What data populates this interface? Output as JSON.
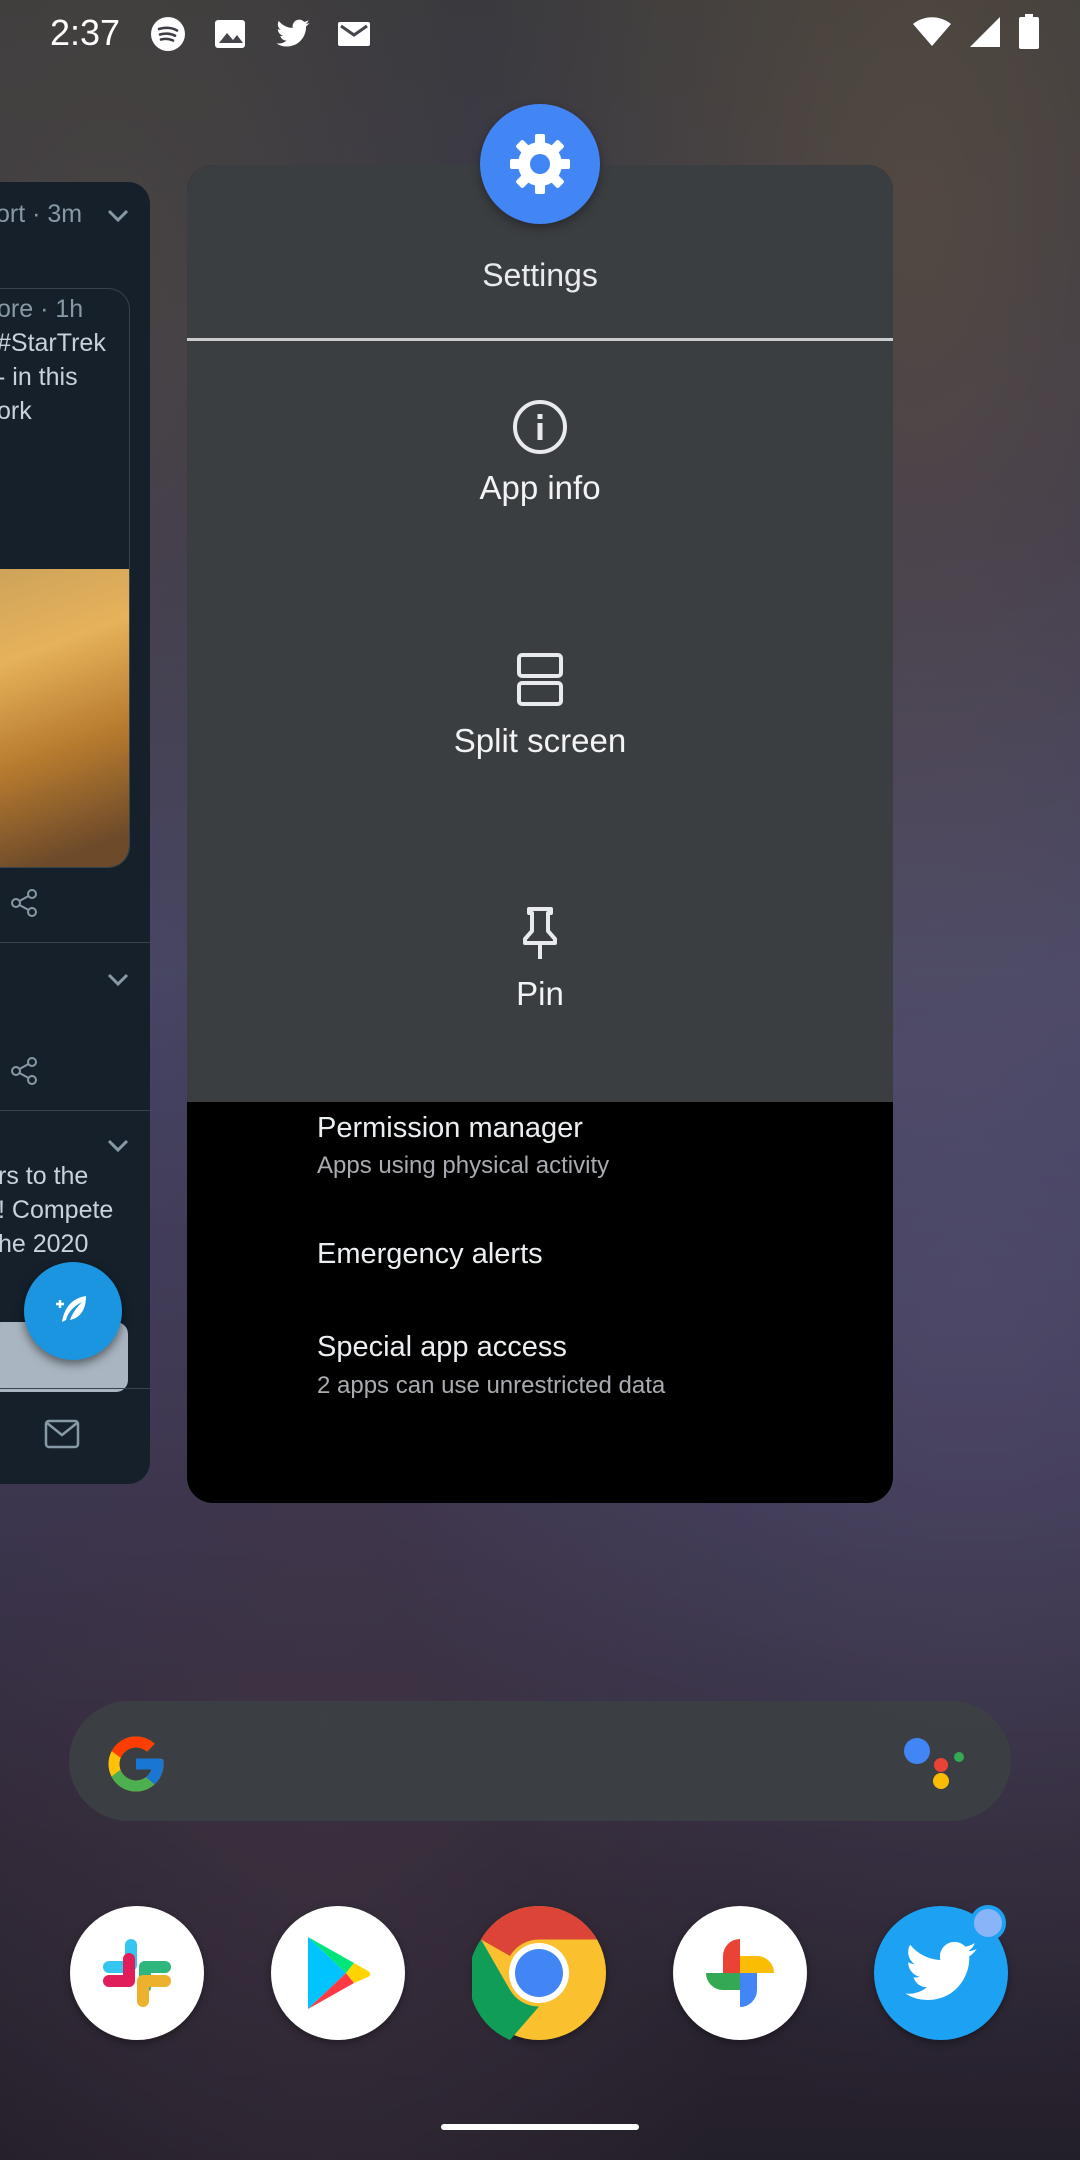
{
  "status_bar": {
    "time": "2:37",
    "left_icons": [
      "spotify-icon",
      "image-icon",
      "twitter-icon",
      "gmail-icon"
    ],
    "right_icons": [
      "wifi-icon",
      "signal-icon",
      "battery-icon"
    ]
  },
  "twitter_card": {
    "lines": [
      "ort · 3m",
      "ore · 1h",
      "#StarTrek",
      "- in this",
      "ork",
      "rs to the",
      "! Compete",
      "he 2020"
    ],
    "accent": "#1b95e0"
  },
  "recent_app": {
    "title": "Settings",
    "menu_items": [
      {
        "label": "App info",
        "icon": "info-icon"
      },
      {
        "label": "Split screen",
        "icon": "split-screen-icon"
      },
      {
        "label": "Pin",
        "icon": "pin-icon"
      }
    ],
    "background_list": [
      {
        "title": "Permission manager",
        "subtitle": "Apps using physical activity"
      },
      {
        "title": "Emergency alerts",
        "subtitle": ""
      },
      {
        "title": "Special app access",
        "subtitle": "2 apps can use unrestricted data"
      }
    ]
  },
  "search": {
    "logo": "google-g-icon",
    "assistant": "google-assistant-icon"
  },
  "dock": [
    "Slack",
    "Play Store",
    "Chrome",
    "Photos",
    "Twitter"
  ],
  "colors": {
    "menu_panel": "#3b3e41",
    "settings_icon": "#4285f4",
    "twitter_bg": "#15202b"
  }
}
